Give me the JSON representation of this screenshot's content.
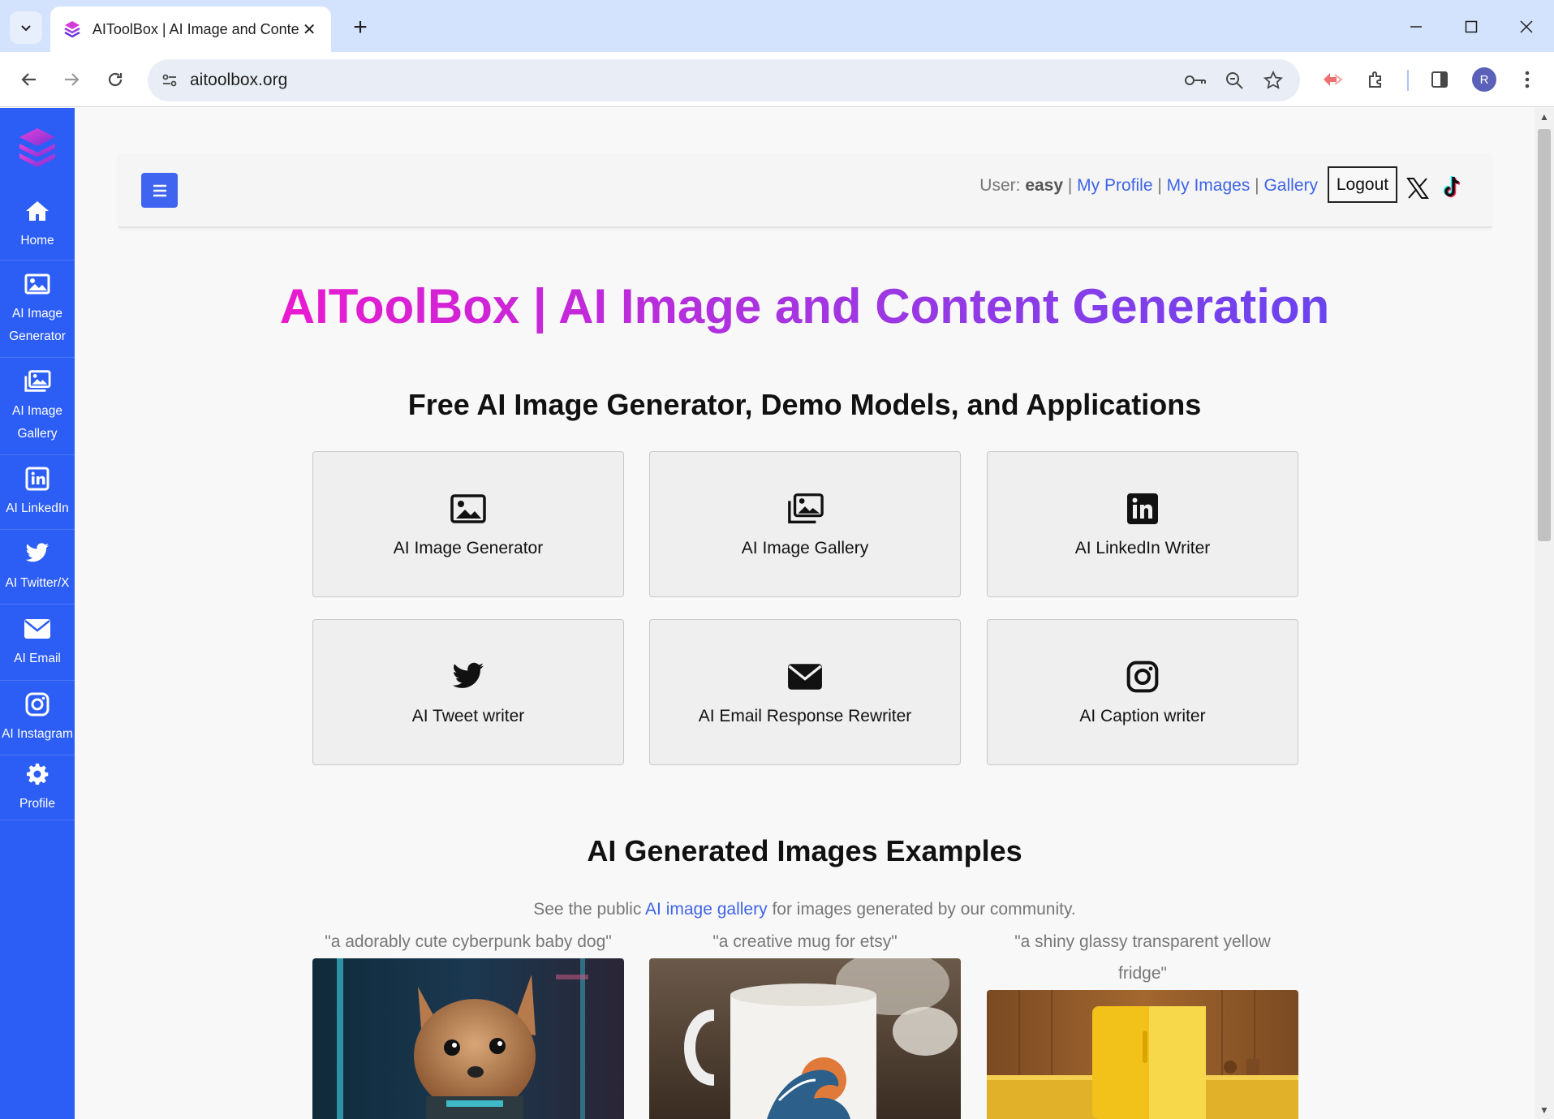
{
  "browser": {
    "tab_title": "AIToolBox | AI Image and Conte",
    "tab_close": "✕",
    "new_tab": "+",
    "url": "aitoolbox.org",
    "profile_initial": "R"
  },
  "sidebar": {
    "items": [
      {
        "label": "Home",
        "icon": "home-icon"
      },
      {
        "label": "AI Image\nGenerator",
        "icon": "image-icon"
      },
      {
        "label": "AI Image\nGallery",
        "icon": "images-icon"
      },
      {
        "label": "AI LinkedIn",
        "icon": "linkedin-icon"
      },
      {
        "label": "AI Twitter/X",
        "icon": "twitter-icon"
      },
      {
        "label": "AI Email",
        "icon": "envelope-icon"
      },
      {
        "label": "AI Instagram",
        "icon": "instagram-icon"
      },
      {
        "label": "Profile",
        "icon": "gear-icon"
      }
    ]
  },
  "topnav": {
    "user_prefix": "User: ",
    "username": "easy",
    "sep": " | ",
    "my_profile": "My Profile",
    "my_images": "My Images",
    "gallery": "Gallery",
    "logout": "Logout"
  },
  "hero": {
    "title": "AIToolBox | AI Image and Content Generation",
    "subtitle": "Free AI Image Generator, Demo Models, and Applications"
  },
  "cards": [
    {
      "label": "AI Image Generator",
      "icon": "image-icon"
    },
    {
      "label": "AI Image Gallery",
      "icon": "images-icon"
    },
    {
      "label": "AI LinkedIn Writer",
      "icon": "linkedin-icon"
    },
    {
      "label": "AI Tweet writer",
      "icon": "twitter-icon"
    },
    {
      "label": "AI Email Response Rewriter",
      "icon": "envelope-icon"
    },
    {
      "label": "AI Caption writer",
      "icon": "instagram-icon"
    }
  ],
  "examples": {
    "heading": "AI Generated Images Examples",
    "see_prefix": "See the public ",
    "see_link": "AI image gallery",
    "see_suffix": " for images generated by our community.",
    "items": [
      {
        "caption": "\"a adorably cute cyberpunk baby dog\""
      },
      {
        "caption": "\"a creative mug for etsy\""
      },
      {
        "caption": "\"a shiny glassy transparent yellow fridge\""
      }
    ]
  },
  "colors": {
    "sidebar": "#2c5df5",
    "link": "#3f64e8",
    "hero_gradient_start": "#ea1ad0",
    "hero_gradient_end": "#6a44f0"
  }
}
